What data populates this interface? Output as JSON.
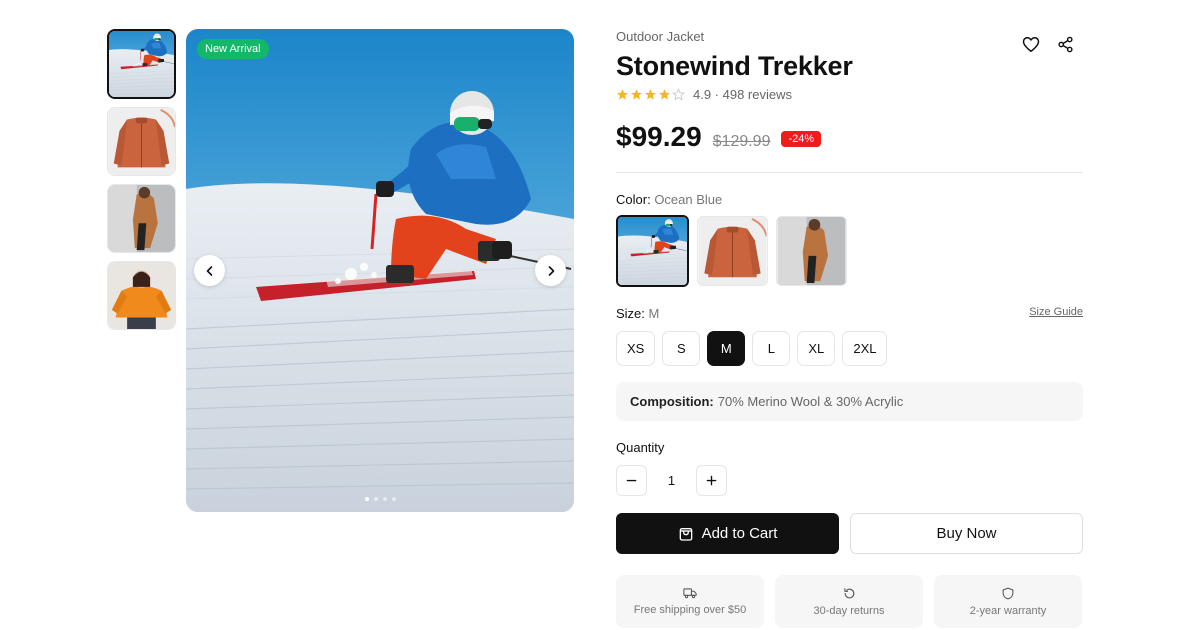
{
  "gallery": {
    "badge": "New Arrival",
    "thumbnails": [
      "skier",
      "jacket-front",
      "model-side",
      "model-orange"
    ],
    "active_index": 0,
    "dots_count": 4,
    "active_dot": 0
  },
  "product": {
    "category": "Outdoor Jacket",
    "title": "Stonewind Trekker",
    "rating_value": 4.9,
    "rating_text": "4.9 · 498 reviews",
    "stars_filled": 4,
    "price": "$99.29",
    "old_price": "$129.99",
    "discount": "-24%"
  },
  "color": {
    "label": "Color:",
    "selected": "Ocean Blue",
    "options": [
      "skier",
      "jacket-front",
      "model-side"
    ]
  },
  "size": {
    "label": "Size:",
    "selected": "M",
    "guide_label": "Size Guide",
    "options": [
      "XS",
      "S",
      "M",
      "L",
      "XL",
      "2XL"
    ]
  },
  "composition": {
    "label": "Composition:",
    "value": "70% Merino Wool & 30% Acrylic"
  },
  "quantity": {
    "label": "Quantity",
    "value": "1"
  },
  "actions": {
    "add_to_cart": "Add to Cart",
    "buy_now": "Buy Now"
  },
  "perks": [
    {
      "icon": "truck-icon",
      "label": "Free shipping over $50"
    },
    {
      "icon": "return-icon",
      "label": "30-day returns"
    },
    {
      "icon": "shield-icon",
      "label": "2-year warranty"
    }
  ],
  "colors": {
    "primary": "#111111",
    "badge_green": "#12b76a",
    "discount_red": "#ef1c1c",
    "star": "#f5b81c"
  }
}
